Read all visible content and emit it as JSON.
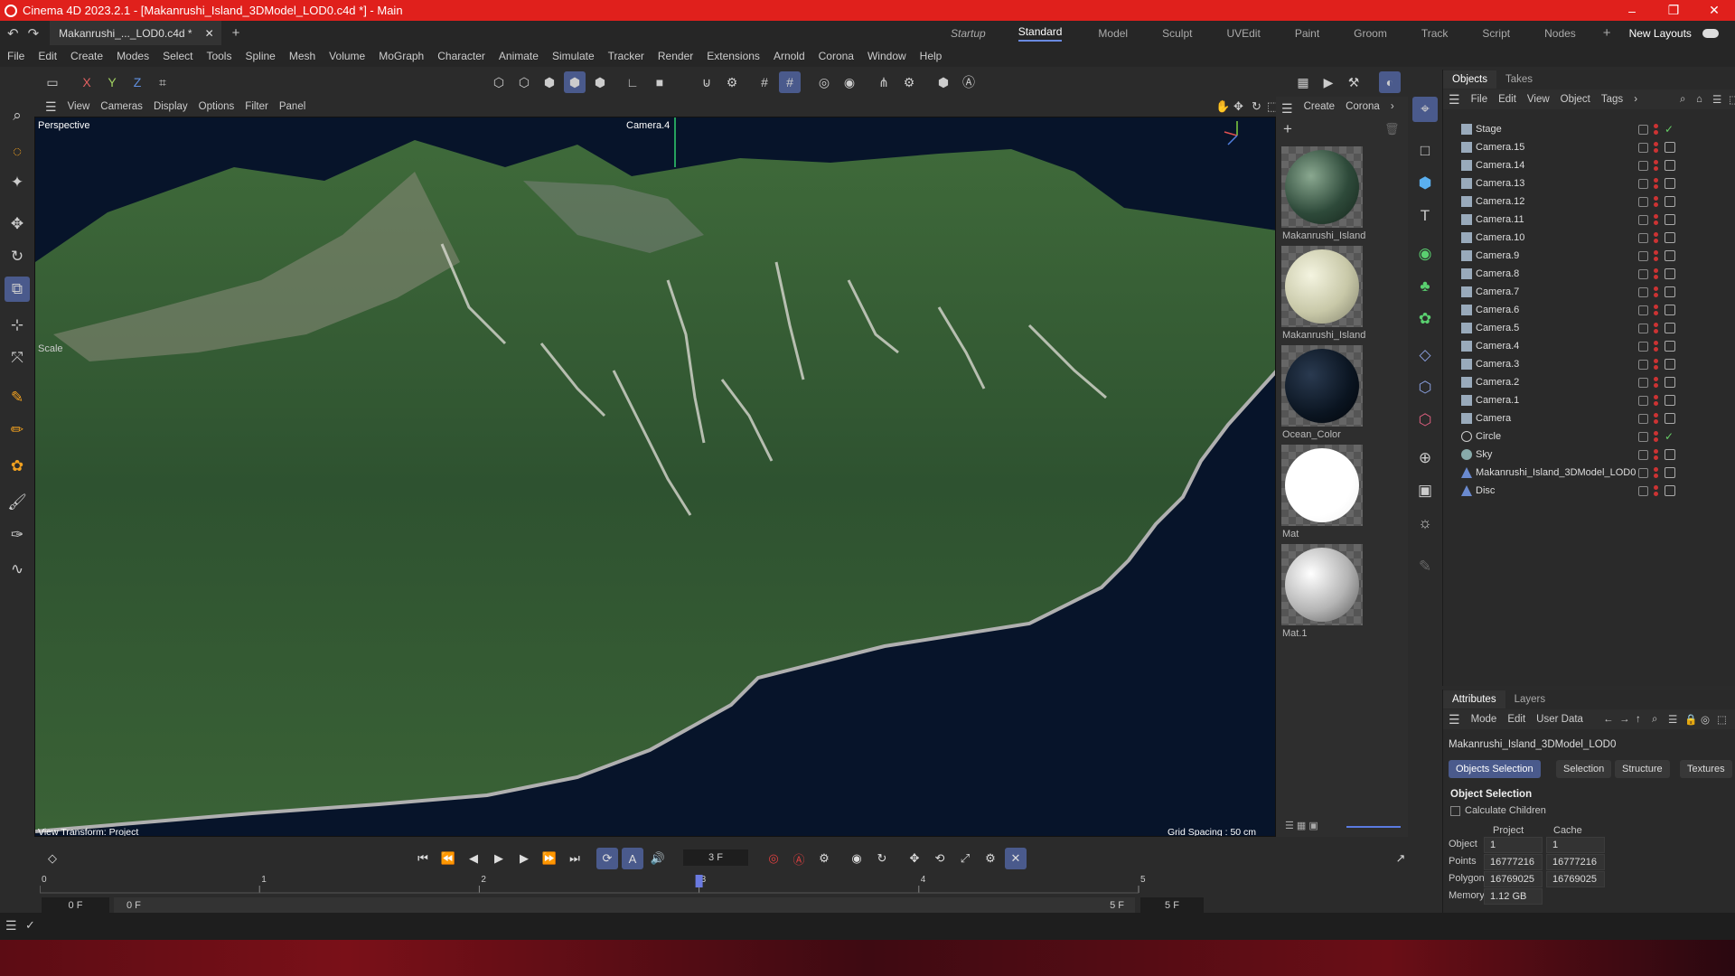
{
  "window": {
    "title": "Cinema 4D 2023.2.1 - [Makanrushi_Island_3DModel_LOD0.c4d *] - Main",
    "min": "–",
    "max": "❐",
    "close": "✕"
  },
  "tab": {
    "doc": "Makanrushi_..._LOD0.c4d *",
    "close": "✕",
    "add": "+"
  },
  "layouts": {
    "items": [
      "Startup",
      "Standard",
      "Model",
      "Sculpt",
      "UVEdit",
      "Paint",
      "Groom",
      "Track",
      "Script",
      "Nodes"
    ],
    "plus": "+",
    "new": "New Layouts"
  },
  "menu": [
    "File",
    "Edit",
    "Create",
    "Modes",
    "Select",
    "Tools",
    "Spline",
    "Mesh",
    "Volume",
    "MoGraph",
    "Character",
    "Animate",
    "Simulate",
    "Tracker",
    "Render",
    "Extensions",
    "Arnold",
    "Corona",
    "Window",
    "Help"
  ],
  "toolbar": {
    "x": "X",
    "y": "Y",
    "z": "Z"
  },
  "viewport": {
    "menu": [
      "View",
      "Cameras",
      "Display",
      "Options",
      "Filter",
      "Panel"
    ],
    "label": "Perspective",
    "camera": "Camera.4",
    "scale": "Scale",
    "transform": "View Transform: Project",
    "grid": "Grid Spacing : 50 cm"
  },
  "materials": {
    "menu": [
      "Create",
      "Corona"
    ],
    "items": [
      {
        "name": "Makanrushi_Island",
        "color": "#2e4a3a"
      },
      {
        "name": "Makanrushi_Island",
        "color": "#c8c8a8"
      },
      {
        "name": "Ocean_Color",
        "color": "#0a1420"
      },
      {
        "name": "Mat",
        "color": "#ffffff"
      },
      {
        "name": "Mat.1",
        "color": "#b4b4b4"
      }
    ]
  },
  "objects": {
    "tabs": [
      "Objects",
      "Takes"
    ],
    "menu": [
      "File",
      "Edit",
      "View",
      "Object",
      "Tags"
    ],
    "items": [
      "Stage",
      "Camera.15",
      "Camera.14",
      "Camera.13",
      "Camera.12",
      "Camera.11",
      "Camera.10",
      "Camera.9",
      "Camera.8",
      "Camera.7",
      "Camera.6",
      "Camera.5",
      "Camera.4",
      "Camera.3",
      "Camera.2",
      "Camera.1",
      "Camera",
      "Circle",
      "Sky",
      "Makanrushi_Island_3DModel_LOD0",
      "Disc"
    ]
  },
  "attributes": {
    "tabs": [
      "Attributes",
      "Layers"
    ],
    "menu": [
      "Mode",
      "Edit",
      "User Data"
    ],
    "object": "Makanrushi_Island_3DModel_LOD0",
    "buttons": [
      "Objects Selection",
      "Selection",
      "Structure",
      "Textures"
    ],
    "section": "Object Selection",
    "calc": "Calculate Children",
    "col_project": "Project",
    "col_cache": "Cache",
    "rows": [
      {
        "label": "Object",
        "project": "1",
        "cache": "1"
      },
      {
        "label": "Points",
        "project": "16777216",
        "cache": "16777216"
      },
      {
        "label": "Polygons",
        "project": "16769025",
        "cache": "16769025"
      },
      {
        "label": "Memory",
        "project": "1.12 GB",
        "cache": ""
      }
    ]
  },
  "timeline": {
    "frame": "3 F",
    "ticks": [
      "0",
      "1",
      "2",
      "3",
      "4",
      "5"
    ],
    "start": "0 F",
    "start2": "0 F",
    "end": "5 F",
    "end2": "5 F",
    "current_fraction": 0.6
  }
}
